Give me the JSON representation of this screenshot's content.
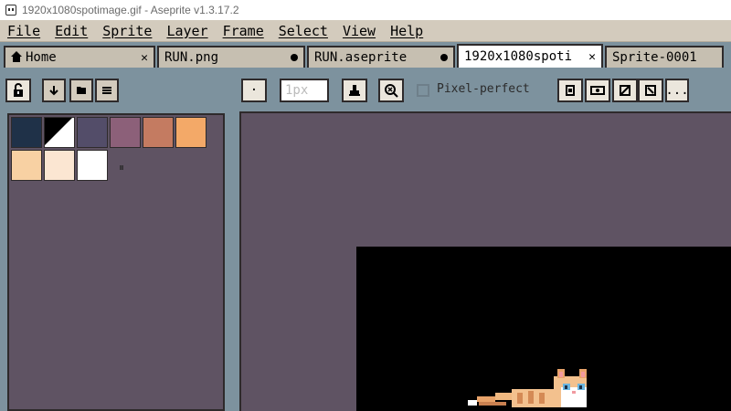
{
  "window": {
    "title": "1920x1080spotimage.gif - Aseprite v1.3.17.2"
  },
  "menu": [
    "File",
    "Edit",
    "Sprite",
    "Layer",
    "Frame",
    "Select",
    "View",
    "Help"
  ],
  "tabs": [
    {
      "label": "Home",
      "indicator": "close",
      "icon": "home-icon"
    },
    {
      "label": "RUN.png",
      "indicator": "dot"
    },
    {
      "label": "RUN.aseprite",
      "indicator": "dot"
    },
    {
      "label": "1920x1080spoti",
      "indicator": "close",
      "active": true
    },
    {
      "label": "Sprite-0001",
      "indicator": "none"
    }
  ],
  "toolbar": {
    "lock_icon": "lock-icon",
    "buttons_left": [
      "arrow-down-icon",
      "folder-icon",
      "menu-icon"
    ],
    "brush_type": "·",
    "brush_size_placeholder": "1px",
    "pixel_perfect_label": "Pixel-perfect",
    "pixel_perfect_checked": false,
    "right_buttons": [
      "...",
      "more"
    ]
  },
  "palette": {
    "colors": [
      "#1f3148",
      "#25394f",
      "#534d69",
      "#8c6079",
      "#c47b61",
      "#f3a968",
      "#f8d1a3",
      "#fbe6d2",
      "#ffffff"
    ],
    "handle": "⏸"
  },
  "colors": {
    "chrome": "#7d929e",
    "canvas_bg": "#5f5363",
    "sprite_bg": "#000000"
  }
}
